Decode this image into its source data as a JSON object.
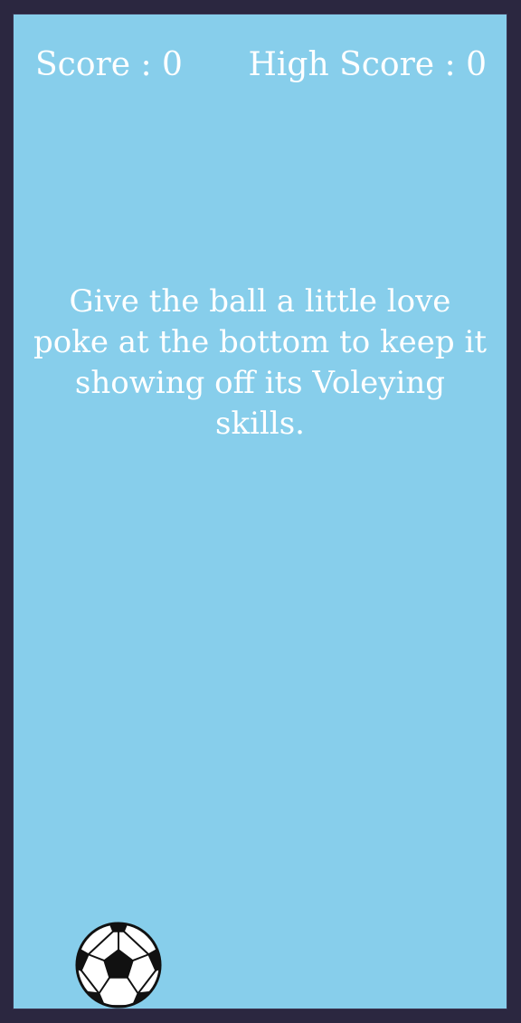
{
  "hud": {
    "score_label": "Score : 0",
    "high_score_label": "High Score : 0"
  },
  "instructions": {
    "text": "Give the ball a little love poke at the bottom to keep it showing off its Voleying skills."
  },
  "colors": {
    "background": "#2b2740",
    "sky": "#87ceeb",
    "text": "#ffffff"
  },
  "icons": {
    "ball": "soccer-ball-icon"
  }
}
